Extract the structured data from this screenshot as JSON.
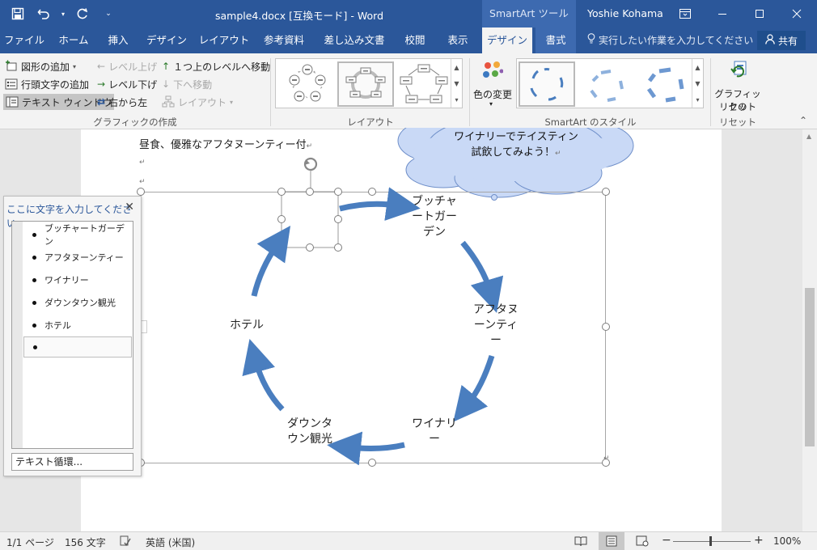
{
  "titlebar": {
    "document_title": "sample4.docx [互換モード] - Word",
    "contextual_tab": "SmartArt ツール",
    "user": "Yoshie Kohama"
  },
  "tabs": [
    {
      "label": "ファイル"
    },
    {
      "label": "ホーム"
    },
    {
      "label": "挿入"
    },
    {
      "label": "デザイン"
    },
    {
      "label": "レイアウト"
    },
    {
      "label": "参考資料"
    },
    {
      "label": "差し込み文書"
    },
    {
      "label": "校閲"
    },
    {
      "label": "表示"
    },
    {
      "label": "デザイン"
    },
    {
      "label": "書式"
    }
  ],
  "tell_me": "実行したい作業を入力してください",
  "share": "共有",
  "ribbon": {
    "create_group": {
      "add_shape": "図形の追加",
      "add_bullet": "行頭文字の追加",
      "text_pane": "テキスト ウィンドウ",
      "promote": "レベル上げ",
      "demote": "レベル下げ",
      "right_to_left": "右から左",
      "move_up": "１つ上のレベルへ移動",
      "move_down": "下へ移動",
      "layout": "レイアウト",
      "label": "グラフィックの作成"
    },
    "layouts_group": {
      "label": "レイアウト"
    },
    "styles_group": {
      "change_colors_line1": "色の変更",
      "label": "SmartArt のスタイル"
    },
    "reset_group": {
      "reset_line1": "グラフィックの",
      "reset_line2": "リセット",
      "label": "リセット"
    }
  },
  "document": {
    "body_line": "昼食、優雅なアフタヌーンティー付",
    "callout_line1": "ワイナリーでテイスティン",
    "callout_line2": "試飲してみよう！"
  },
  "smartart": {
    "nodes": [
      {
        "line1": "ブッチャ",
        "line2": "ートガー",
        "line3": "デン"
      },
      {
        "line1": "アフタヌ",
        "line2": "ーンティ",
        "line3": "ー"
      },
      {
        "line1": "ワイナリ",
        "line2": "ー"
      },
      {
        "line1": "ダウンタ",
        "line2": "ウン観光"
      },
      {
        "line1": "ホテル"
      }
    ]
  },
  "text_pane": {
    "title": "ここに文字を入力してください",
    "items": [
      {
        "text": "ブッチャートガーデン"
      },
      {
        "text": "アフタヌーンティー"
      },
      {
        "text": "ワイナリー"
      },
      {
        "text": "ダウンタウン観光"
      },
      {
        "text": "ホテル"
      },
      {
        "text": ""
      }
    ],
    "footer": "テキスト循環..."
  },
  "statusbar": {
    "page": "1/1 ページ",
    "words": "156 文字",
    "language": "英語 (米国)",
    "zoom": "100%"
  },
  "colors": {
    "word_blue": "#2b579a",
    "arrow_blue": "#4a7ebf",
    "callout_fill": "#c9d9f6"
  }
}
